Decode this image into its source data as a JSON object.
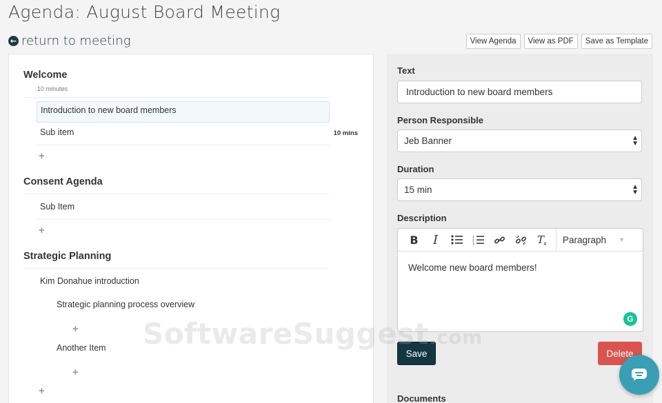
{
  "page": {
    "title": "Agenda: August Board Meeting",
    "return_label": "return to meeting",
    "return_icon": "circle-arrow-left-icon"
  },
  "toolbar": {
    "view_agenda": "View Agenda",
    "view_pdf": "View as PDF",
    "save_template": "Save as Template"
  },
  "agenda": {
    "sections": [
      {
        "title": "Welcome",
        "subtitle": "10 minutes",
        "items": [
          {
            "label": "Introduction to new board members",
            "selected": true
          },
          {
            "label": "Sub item",
            "duration": "10 mins"
          }
        ]
      },
      {
        "title": "Consent Agenda",
        "items": [
          {
            "label": "Sub Item"
          }
        ]
      },
      {
        "title": "Strategic Planning",
        "items": [
          {
            "label": "Kim Donahue introduction",
            "children": [
              {
                "label": "Strategic planning process overview"
              },
              {
                "label": "Another Item"
              }
            ]
          }
        ]
      }
    ],
    "add_symbol": "+"
  },
  "editor": {
    "text_label": "Text",
    "text_value": "Introduction to new board members",
    "person_label": "Person Responsible",
    "person_value": "Jeb Banner",
    "duration_label": "Duration",
    "duration_value": "15 min",
    "description_label": "Description",
    "paragraph_format": "Paragraph",
    "description_value": "Welcome new board members!",
    "save_label": "Save",
    "delete_label": "Delete",
    "documents_label": "Documents",
    "grammarly_badge": "G"
  },
  "watermark": {
    "text": "SoftwareSuggest",
    "suffix": ".com"
  },
  "colors": {
    "save": "#143642",
    "delete": "#d9534f",
    "chat": "#3a9fb5"
  }
}
